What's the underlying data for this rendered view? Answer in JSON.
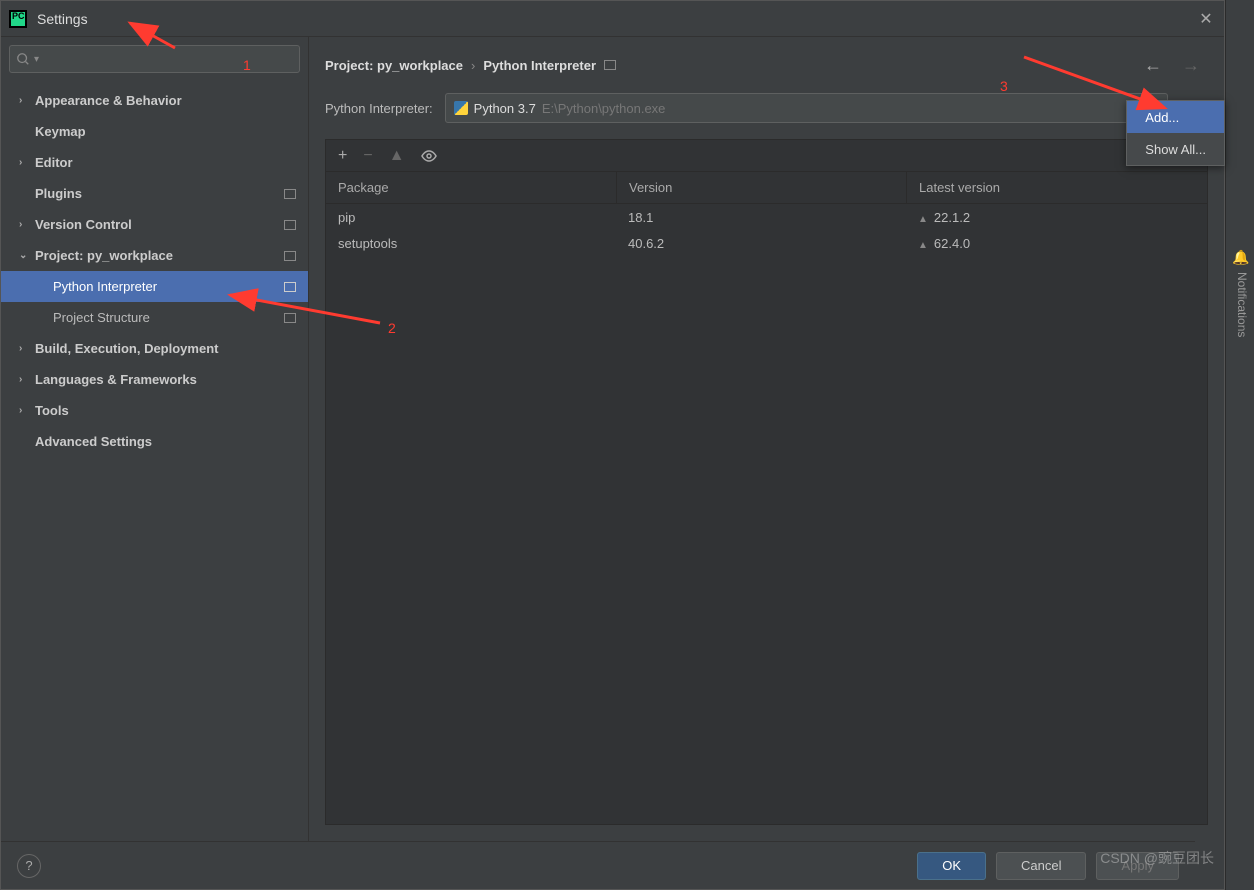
{
  "title": "Settings",
  "search": {
    "placeholder": ""
  },
  "sidebar": {
    "items": [
      {
        "label": "Appearance & Behavior",
        "expandable": true,
        "bold": true
      },
      {
        "label": "Keymap",
        "expandable": false,
        "bold": true
      },
      {
        "label": "Editor",
        "expandable": true,
        "bold": true
      },
      {
        "label": "Plugins",
        "expandable": false,
        "bold": true,
        "badge": true
      },
      {
        "label": "Version Control",
        "expandable": true,
        "bold": true,
        "badge": true
      },
      {
        "label": "Project: py_workplace",
        "expandable": true,
        "expanded": true,
        "bold": true,
        "badge": true
      },
      {
        "label": "Python Interpreter",
        "child": true,
        "selected": true,
        "badge": true
      },
      {
        "label": "Project Structure",
        "child": true,
        "badge": true
      },
      {
        "label": "Build, Execution, Deployment",
        "expandable": true,
        "bold": true
      },
      {
        "label": "Languages & Frameworks",
        "expandable": true,
        "bold": true
      },
      {
        "label": "Tools",
        "expandable": true,
        "bold": true
      },
      {
        "label": "Advanced Settings",
        "expandable": false,
        "bold": true
      }
    ]
  },
  "breadcrumb": {
    "parent": "Project: py_workplace",
    "sep": "›",
    "current": "Python Interpreter"
  },
  "interpreter": {
    "label": "Python Interpreter:",
    "name": "Python 3.7",
    "path": "E:\\Python\\python.exe"
  },
  "dropdown": {
    "items": [
      "Add...",
      "Show All..."
    ]
  },
  "packages": {
    "headers": [
      "Package",
      "Version",
      "Latest version"
    ],
    "rows": [
      {
        "name": "pip",
        "version": "18.1",
        "latest": "22.1.2",
        "upgrade": true
      },
      {
        "name": "setuptools",
        "version": "40.6.2",
        "latest": "62.4.0",
        "upgrade": true
      }
    ]
  },
  "footer": {
    "ok": "OK",
    "cancel": "Cancel",
    "apply": "Apply"
  },
  "notif_label": "Notifications",
  "annotations": {
    "a1": "1",
    "a2": "2",
    "a3": "3"
  },
  "watermark": "CSDN @豌豆团长"
}
